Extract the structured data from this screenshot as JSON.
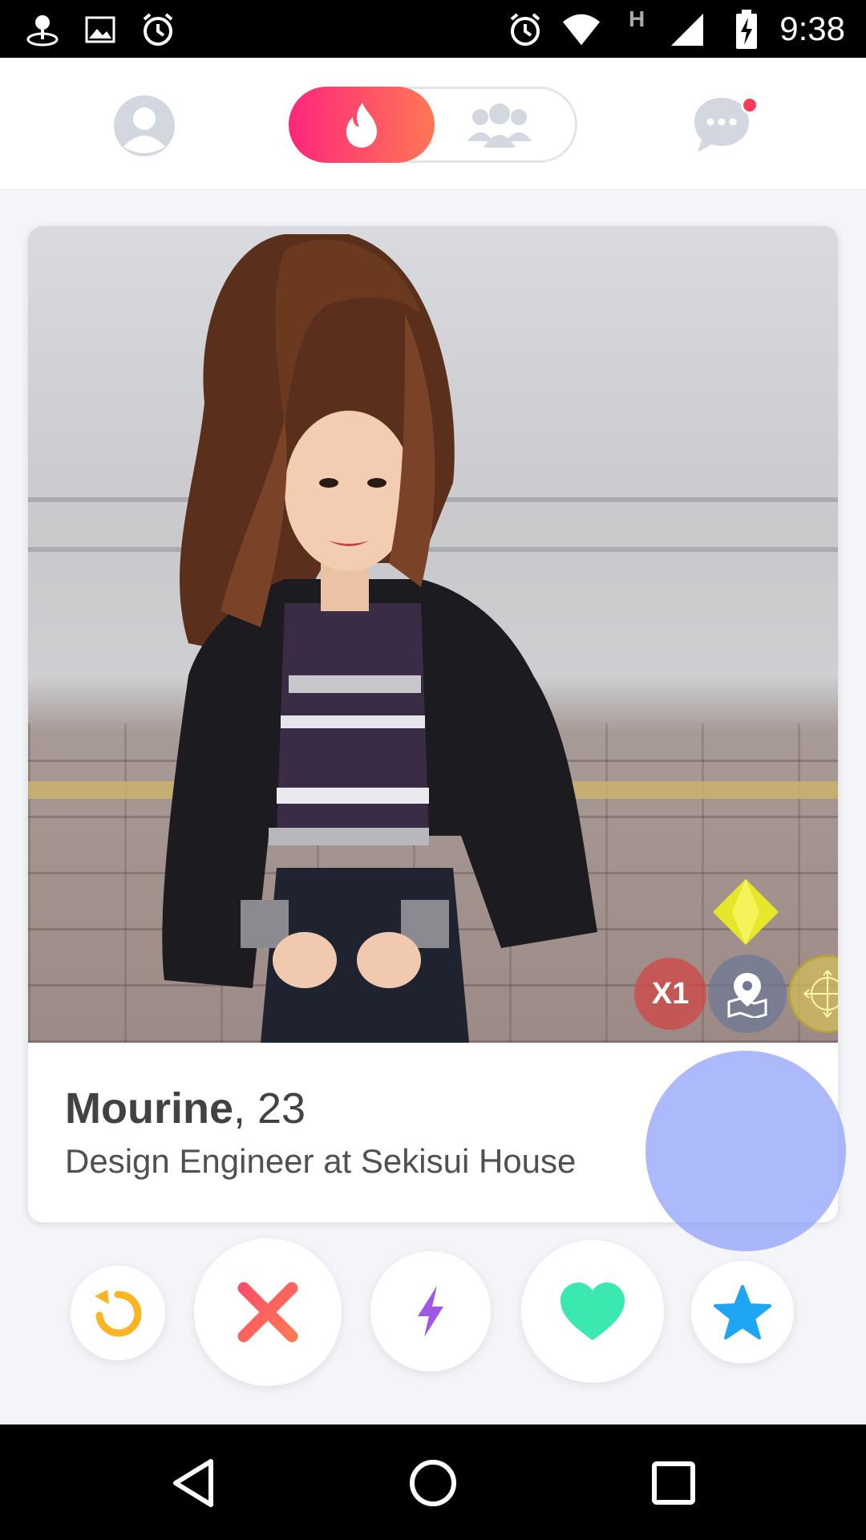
{
  "status_bar": {
    "time": "9:38",
    "network_label": "H",
    "icons": [
      "location-icon",
      "image-icon",
      "alarm-icon",
      "alarm-icon",
      "wifi-icon",
      "signal-icon",
      "battery-charging-icon"
    ]
  },
  "top_nav": {
    "profile_icon": "profile-icon",
    "toggle": {
      "active": "flame-icon",
      "inactive": "group-icon"
    },
    "messages_icon": "chat-bubble-icon",
    "messages_has_notification": true
  },
  "card": {
    "name": "Mourine",
    "age_text": ", 23",
    "job": "Design Engineer at Sekisui House",
    "badges": {
      "boost_count": "X1"
    }
  },
  "actions": [
    {
      "name": "rewind-button",
      "icon": "rewind-icon",
      "color": "#fbb524"
    },
    {
      "name": "nope-button",
      "icon": "close-icon",
      "color": "#fd5068"
    },
    {
      "name": "boost-button",
      "icon": "lightning-icon",
      "color": "#a157e6"
    },
    {
      "name": "like-button",
      "icon": "heart-icon",
      "color": "#3be8b0"
    },
    {
      "name": "superlike-button",
      "icon": "star-icon",
      "color": "#1ea5f4"
    }
  ],
  "colors": {
    "brand_gradient_start": "#fd267d",
    "brand_gradient_end": "#ff7854",
    "notification_dot": "#fd3a5c"
  }
}
